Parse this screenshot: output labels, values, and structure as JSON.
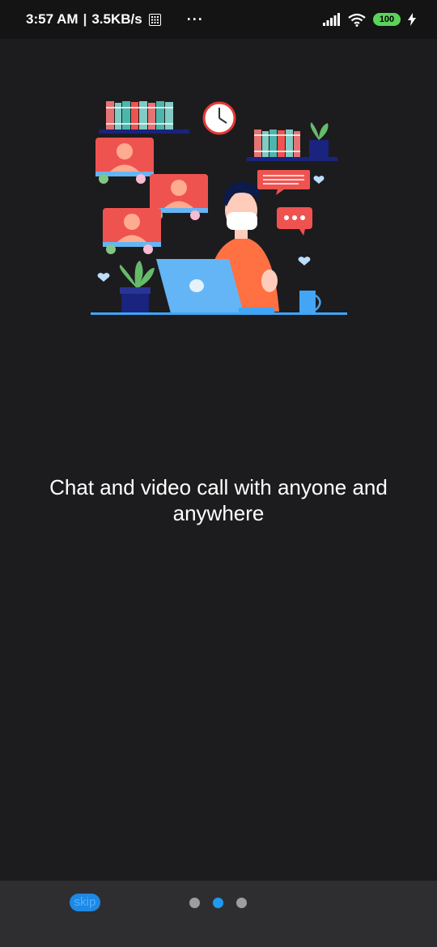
{
  "status_bar": {
    "time": "3:57 AM",
    "separator": "|",
    "speed": "3.5KB/s",
    "more": "···",
    "battery": "100"
  },
  "onboarding": {
    "headline": "Chat and video call with anyone and anywhere"
  },
  "footer": {
    "skip_label": "skip",
    "page_count": 3,
    "active_page": 2
  }
}
